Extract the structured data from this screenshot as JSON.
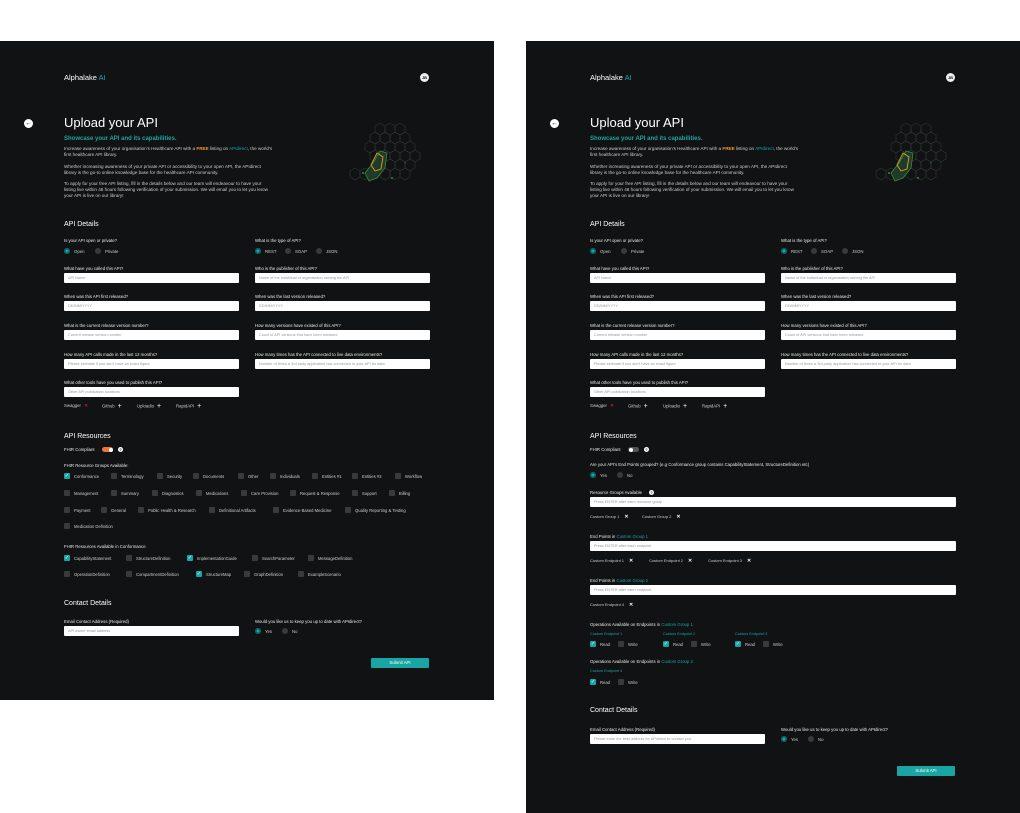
{
  "brand": {
    "name": "Alphalake",
    "ai": "AI",
    "avatar": "JB"
  },
  "page": {
    "title": "Upload your API",
    "subtitle": "Showcase your API and its capabilities.",
    "intro1a": "Increase awareness of your organisation's Healthcare API with a ",
    "intro1free": "FREE",
    "intro1b": " listing on ",
    "intro1link": "APIdirect",
    "intro1c": ", the world's first healthcare API library.",
    "intro2": "Whether increasing awareness of your private API or accessibility to your open API, the APIdirect library is the go-to online knowledge base for the healthcare API community.",
    "intro3": "To apply for your free API listing, fill in the details below and our team will endeavour to have your listing live within 48 hours following verification of your submission. We will email you to let you know your API is live on our library!"
  },
  "api_details": {
    "heading": "API Details",
    "open_private_q": "Is your API open or private?",
    "open": "Open",
    "private": "Private",
    "type_q": "What is the type of API?",
    "rest": "REST",
    "soap": "SOAP",
    "json": "JSON",
    "name_q": "What have you called this API?",
    "name_ph": "API Name",
    "publisher_q": "Who is the publisher of this API?",
    "publisher_ph": "Name of the individual or organisation owning the API",
    "first_q": "When was this API first released?",
    "first_ph": "DD/MM/YYYY",
    "last_q": "When was the last version released?",
    "last_ph": "DD/MM/YYYY",
    "version_q": "What is the current release version number?",
    "version_ph": "Current release version number",
    "versions_q": "How many versions have existed of this API?",
    "versions_ph": "Count of API versions that have been released",
    "calls_q": "How many API calls made in the last 12 months?",
    "calls_ph": "Please estimate if you don't have an exact figure",
    "live_q": "How many times has the API connected to live data environments?",
    "live_ph": "Number of times a 3rd party application has connected to your API for data",
    "tools_q": "What other tools have you used to publish this API?",
    "tools_ph": "Other API publication locations",
    "tools": [
      "Swagger",
      "Github",
      "Uploadio",
      "RapidAPI"
    ]
  },
  "resources": {
    "heading": "API Resources",
    "fhir_compliant": "FHIR Compliant",
    "groups_label": "FHIR Resource Groups Available:",
    "groups": [
      [
        "Conformance",
        "Terminology",
        "Security",
        "Documents",
        "Other",
        "Individuals",
        "Entities #1",
        "Entities #2",
        "Workflow"
      ],
      [
        "Management",
        "Summary",
        "Diagnostics",
        "Medications",
        "Care Provision",
        "Request & Response",
        "Support",
        "Billing"
      ],
      [
        "Payment",
        "General",
        "Public Health & Research",
        "Definitional Artifacts",
        "Evidence-Based Medicine",
        "Quality Reporting & Testing"
      ],
      [
        "Medication Definition"
      ]
    ],
    "conf_label": "FHIR Resources Available in Conformance",
    "conf": [
      [
        "CapabilityStatement",
        "StructureDefinition",
        "ImplementationGuide",
        "SearchParameter",
        "MessageDefinition"
      ],
      [
        "OperationDefinition",
        "CompartmentDefinition",
        "StructureMap",
        "GraphDefinition",
        "ExampleScenario"
      ]
    ],
    "grouped_q": "Are your API's End Points grouped? (e.g Conformance group contains CapabilityStatement, StructureDefinition etc)",
    "yes": "Yes",
    "no": "No",
    "rg_label": "Resource Groups Available",
    "rg_ph": "Press ENTER after each resource group",
    "cg1": "Custom Group 1",
    "cg2": "Custom Group 2",
    "ep_label": "End Points in ",
    "ep_ph": "Press ENTER after each endpoint",
    "ce1": "Custom Endpoint 1",
    "ce2": "Custom Endpoint 2",
    "ce3": "Custom Endpoint 3",
    "ce4": "Custom Endpoint 4",
    "ops_label": "Operations Available on Endpoints in ",
    "read": "Read",
    "write": "Write"
  },
  "contact": {
    "heading": "Contact Details",
    "email_q": "Email Contact Address (Required)",
    "email_ph1": "API owner email address",
    "email_ph2": "Please enter the best address for APIdirect to contact you",
    "update_q": "Would you like us to keep you up to date with APIdirect?",
    "yes": "Yes",
    "no": "No",
    "submit": "Submit API"
  },
  "colors": {
    "bg": "#111213",
    "accent": "#1aa5a5",
    "free": "#f0a020",
    "toggle": "#e8743a"
  }
}
